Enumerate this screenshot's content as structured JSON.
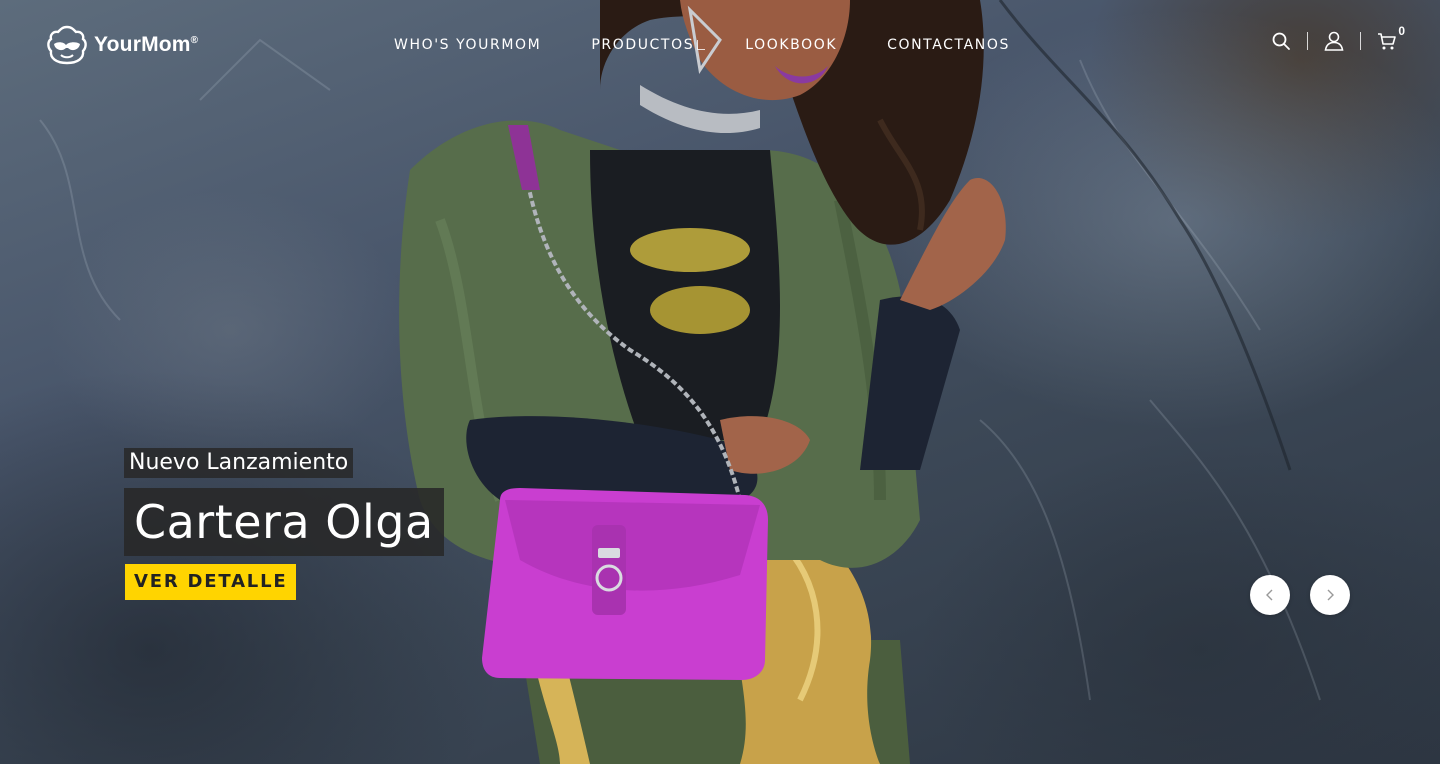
{
  "brand": {
    "name": "YourMom",
    "registered": "®"
  },
  "nav": {
    "items": [
      {
        "label": "WHO'S YOURMOM"
      },
      {
        "label": "PRODUCTOS"
      },
      {
        "label": "LOOKBOOK"
      },
      {
        "label": "CONTACTANOS"
      }
    ]
  },
  "tools": {
    "search_icon": "search-icon",
    "account_icon": "user-icon",
    "cart_icon": "cart-icon",
    "cart_count": "0"
  },
  "slide": {
    "kicker": "Nuevo Lanzamiento",
    "title": "Cartera Olga",
    "cta": "VER DETALLE"
  },
  "colors": {
    "cta_background": "#ffd400",
    "caption_background": "#282828",
    "bag": "#c93ed0"
  }
}
